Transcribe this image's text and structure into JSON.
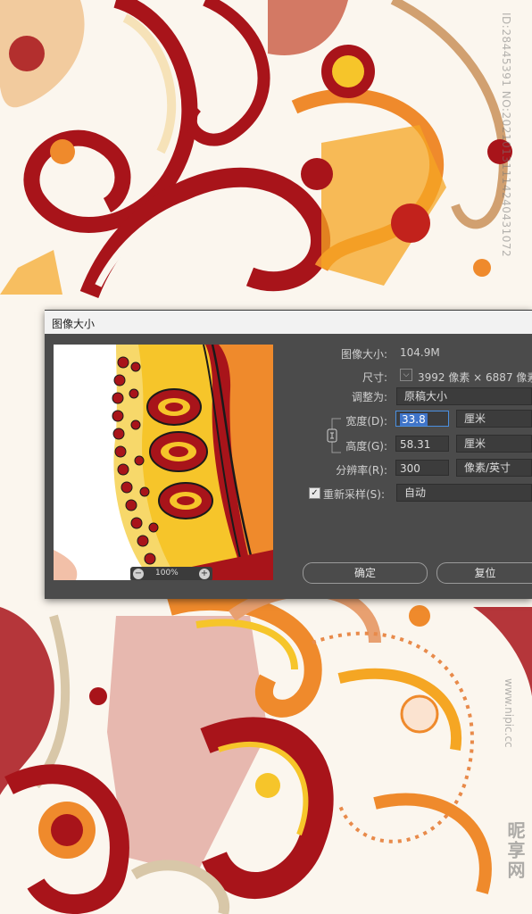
{
  "watermark": {
    "id_text": "ID:28445391 NO:20210131114240431072",
    "brand": "昵享网",
    "url": "www.nipic.cc"
  },
  "dialog": {
    "title": "图像大小",
    "image_size_label": "图像大小:",
    "image_size_value": "104.9M",
    "dimensions_label": "尺寸:",
    "dimensions_value": "3992 像素 × 6887 像素",
    "fit_to_label": "调整为:",
    "fit_to_value": "原稿大小",
    "width_label": "宽度(D):",
    "width_value": "33.8",
    "width_unit": "厘米",
    "height_label": "高度(G):",
    "height_value": "58.31",
    "height_unit": "厘米",
    "resolution_label": "分辨率(R):",
    "resolution_value": "300",
    "resolution_unit": "像素/英寸",
    "resample_label": "重新采样(S):",
    "resample_checked": true,
    "resample_value": "自动",
    "ok_label": "确定",
    "reset_label": "复位",
    "zoom_value": "100%"
  },
  "colors": {
    "dialog_bg": "#4b4b4b",
    "accent_blue": "#3f74c9",
    "paisley_red": "#a8141a",
    "paisley_orange": "#ef8a2c",
    "paisley_yellow": "#f6c52a"
  }
}
